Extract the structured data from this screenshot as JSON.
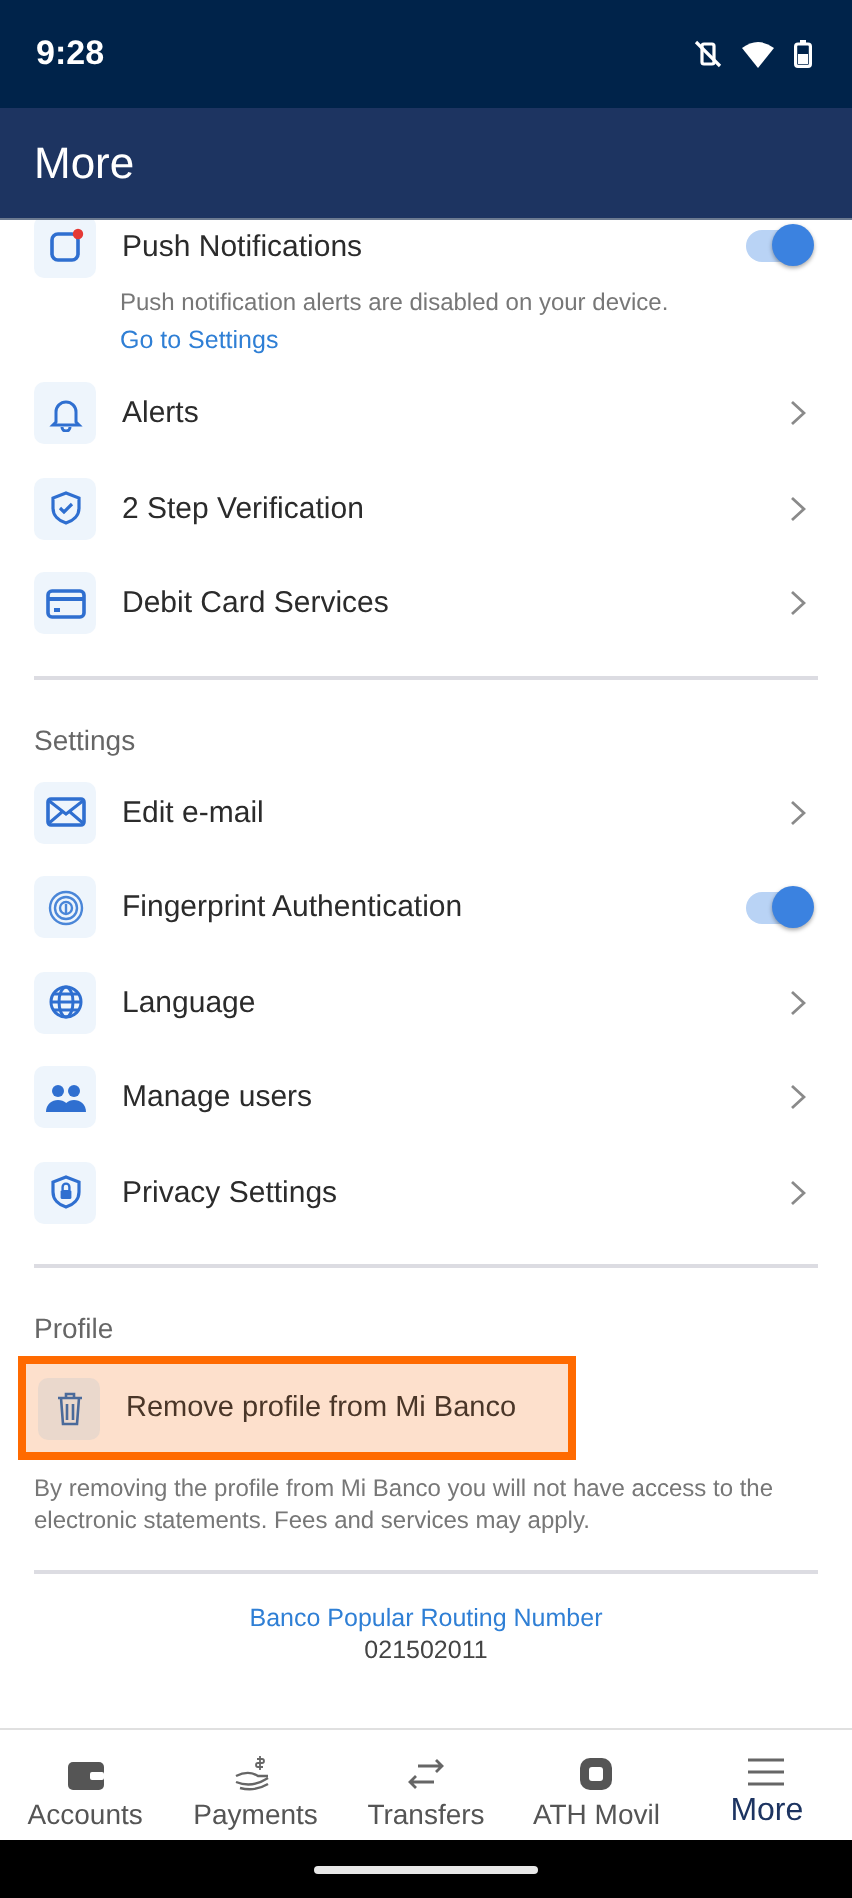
{
  "status_bar": {
    "time": "9:28"
  },
  "header": {
    "title": "More"
  },
  "push": {
    "label": "Push Notifications",
    "on": true,
    "note": "Push notification alerts are disabled on your device.",
    "link": "Go to Settings"
  },
  "items": [
    {
      "label": "Alerts",
      "kind": "chevron"
    },
    {
      "label": "2 Step Verification",
      "kind": "chevron"
    },
    {
      "label": "Debit Card Services",
      "kind": "chevron"
    }
  ],
  "settings": {
    "title": "Settings",
    "items": [
      {
        "label": "Edit e-mail",
        "kind": "chevron"
      },
      {
        "label": "Fingerprint Authentication",
        "kind": "toggle",
        "on": true
      },
      {
        "label": "Language",
        "kind": "chevron"
      },
      {
        "label": "Manage users",
        "kind": "chevron"
      },
      {
        "label": "Privacy Settings",
        "kind": "chevron"
      }
    ]
  },
  "profile": {
    "title": "Profile",
    "action": "Remove profile from Mi Banco",
    "highlighted": true,
    "note": "By removing the profile from Mi Banco you will not have access to the electronic statements. Fees and services may apply."
  },
  "routing": {
    "label": "Banco Popular Routing Number",
    "number": "021502011"
  },
  "nav": [
    {
      "label": "Accounts",
      "selected": false
    },
    {
      "label": "Payments",
      "selected": false
    },
    {
      "label": "Transfers",
      "selected": false
    },
    {
      "label": "ATH Movil",
      "selected": false
    },
    {
      "label": "More",
      "selected": true
    }
  ]
}
